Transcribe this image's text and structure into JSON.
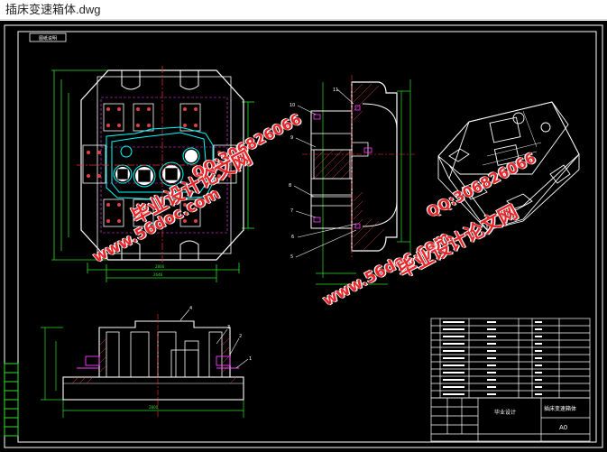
{
  "window": {
    "title": "插床变速箱体.dwg"
  },
  "drawing": {
    "view_label_tl": "图纸说明",
    "title_block_name": "插床变速箱体",
    "title_block_scale": "A0",
    "title_block_company": "毕业设计"
  },
  "watermarks": {
    "url": "www.56doc.com",
    "qq": "QQ:306826066",
    "cn": "毕业设计论文网"
  },
  "balloons": [
    "11",
    "10",
    "9",
    "8",
    "7",
    "6",
    "5",
    "4",
    "3",
    "2",
    "1"
  ],
  "colors": {
    "background": "#000000",
    "outline": "#ffffff",
    "dimension": "#2ce02c",
    "hidden": "#ff3bff",
    "center": "#ff3030",
    "part": "#00ffff",
    "hatch": "#e04040"
  }
}
